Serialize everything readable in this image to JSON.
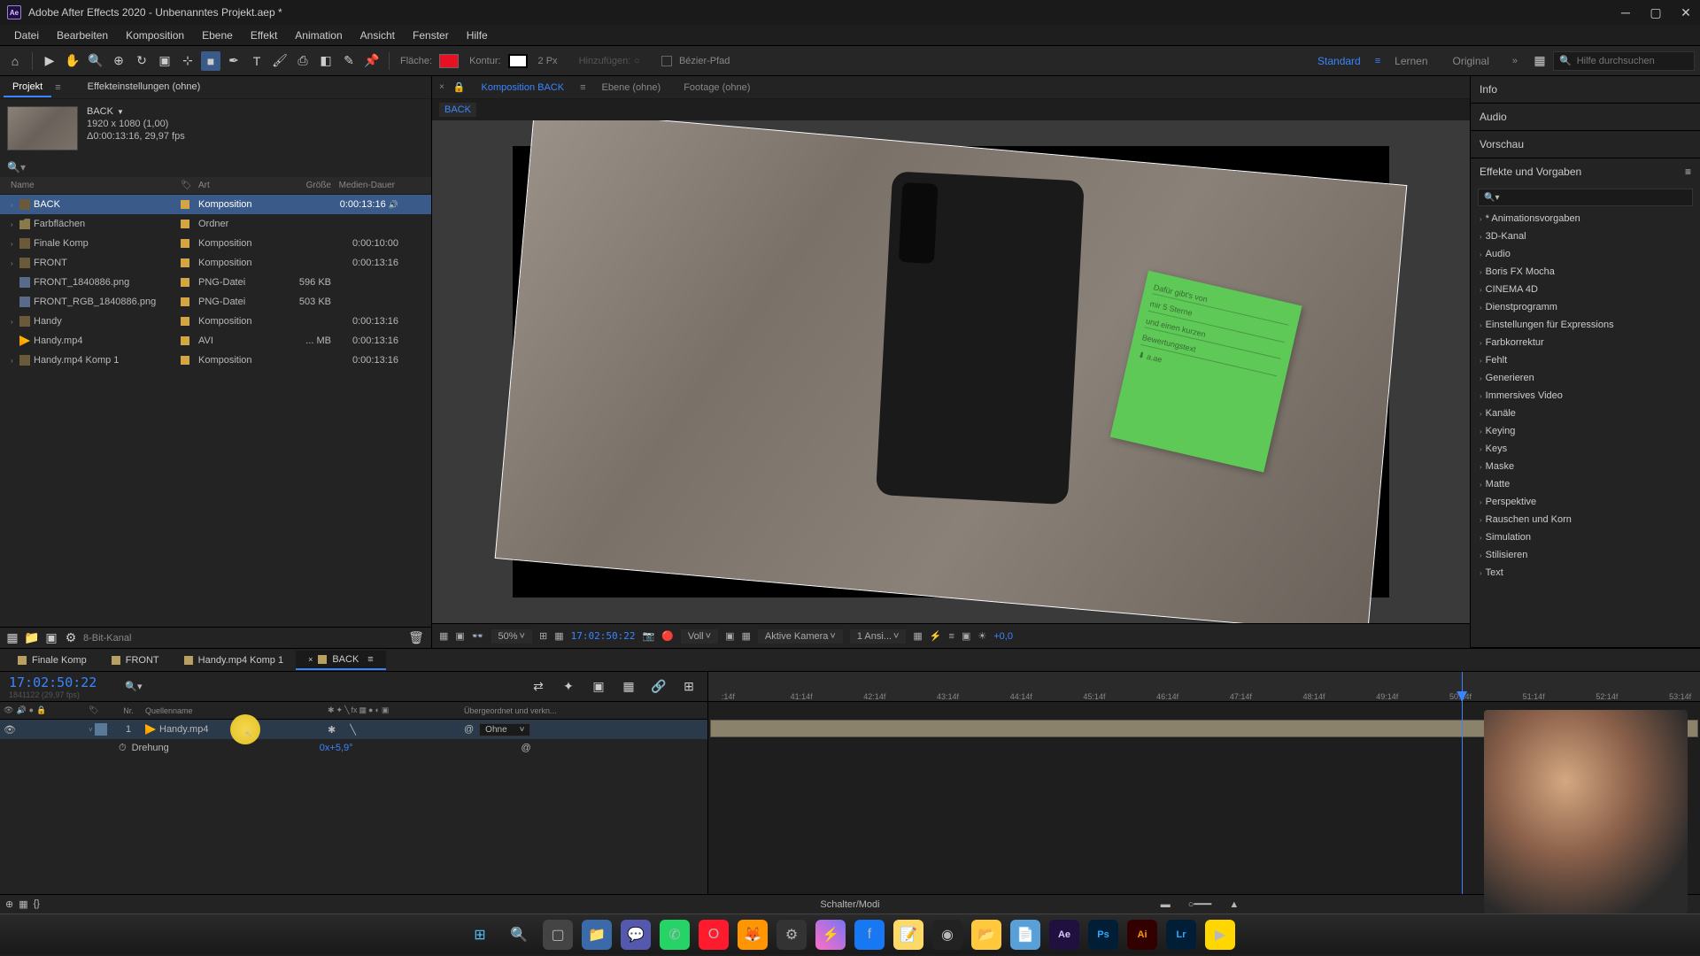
{
  "titlebar": {
    "app_name": "Adobe After Effects 2020",
    "project_title": "Unbenanntes Projekt.aep *"
  },
  "menu": [
    "Datei",
    "Bearbeiten",
    "Komposition",
    "Ebene",
    "Effekt",
    "Animation",
    "Ansicht",
    "Fenster",
    "Hilfe"
  ],
  "toolbar": {
    "fill_label": "Fläche:",
    "stroke_label": "Kontur:",
    "stroke_width": "2 Px",
    "add_label": "Hinzufügen:",
    "bezier_label": "Bézier-Pfad",
    "workspaces": [
      "Standard",
      "Lernen",
      "Original"
    ],
    "search_placeholder": "Hilfe durchsuchen"
  },
  "project_panel": {
    "tabs": {
      "project": "Projekt",
      "effect_settings": "Effekteinstellungen (ohne)"
    },
    "comp_preview": {
      "name": "BACK",
      "dimensions": "1920 x 1080 (1,00)",
      "duration": "Δ0:00:13:16, 29,97 fps"
    },
    "headers": {
      "name": "Name",
      "art": "Art",
      "size": "Größe",
      "dur": "Medien-Dauer"
    },
    "rows": [
      {
        "name": "BACK",
        "art": "Komposition",
        "size": "",
        "dur": "0:00:13:16",
        "icon": "comp",
        "selected": true,
        "trail": true
      },
      {
        "name": "Farbflächen",
        "art": "Ordner",
        "size": "",
        "dur": "",
        "icon": "folder"
      },
      {
        "name": "Finale Komp",
        "art": "Komposition",
        "size": "",
        "dur": "0:00:10:00",
        "icon": "comp"
      },
      {
        "name": "FRONT",
        "art": "Komposition",
        "size": "",
        "dur": "0:00:13:16",
        "icon": "comp"
      },
      {
        "name": "FRONT_1840886.png",
        "art": "PNG-Datei",
        "size": "596 KB",
        "dur": "",
        "icon": "img"
      },
      {
        "name": "FRONT_RGB_1840886.png",
        "art": "PNG-Datei",
        "size": "503 KB",
        "dur": "",
        "icon": "img"
      },
      {
        "name": "Handy",
        "art": "Komposition",
        "size": "",
        "dur": "0:00:13:16",
        "icon": "comp"
      },
      {
        "name": "Handy.mp4",
        "art": "AVI",
        "size": "... MB",
        "dur": "0:00:13:16",
        "icon": "vid"
      },
      {
        "name": "Handy.mp4 Komp 1",
        "art": "Komposition",
        "size": "",
        "dur": "0:00:13:16",
        "icon": "comp"
      }
    ],
    "footer_bpc": "8-Bit-Kanal"
  },
  "viewer": {
    "tabs": {
      "comp": "Komposition BACK",
      "layer": "Ebene (ohne)",
      "footage": "Footage (ohne)"
    },
    "breadcrumb": "BACK",
    "sticky_note_text": "Dafür gibt's von mir 5 Sterne und einen kurzen Bewertungstext ⬇ a.ae",
    "footer": {
      "zoom": "50%",
      "time": "17:02:50:22",
      "res": "Voll",
      "camera": "Aktive Kamera",
      "views": "1 Ansi...",
      "exposure": "+0,0"
    }
  },
  "right": {
    "sections": [
      "Info",
      "Audio",
      "Vorschau"
    ],
    "effects_title": "Effekte und Vorgaben",
    "effects": [
      "* Animationsvorgaben",
      "3D-Kanal",
      "Audio",
      "Boris FX Mocha",
      "CINEMA 4D",
      "Dienstprogramm",
      "Einstellungen für Expressions",
      "Farbkorrektur",
      "Fehlt",
      "Generieren",
      "Immersives Video",
      "Kanäle",
      "Keying",
      "Keys",
      "Maske",
      "Matte",
      "Perspektive",
      "Rauschen und Korn",
      "Simulation",
      "Stilisieren",
      "Text"
    ]
  },
  "timeline": {
    "tabs": [
      {
        "label": "Finale Komp",
        "active": false
      },
      {
        "label": "FRONT",
        "active": false
      },
      {
        "label": "Handy.mp4 Komp 1",
        "active": false
      },
      {
        "label": "BACK",
        "active": true
      }
    ],
    "timecode": "17:02:50:22",
    "timecode_sub": "1841122 (29,97 fps)",
    "headers": {
      "num": "Nr.",
      "source": "Quellenname",
      "parent": "Übergeordnet und verkn..."
    },
    "layer": {
      "num": "1",
      "name": "Handy.mp4",
      "parent_value": "Ohne",
      "prop_name": "Drehung",
      "prop_value": "0x+5,9°"
    },
    "ruler_ticks": [
      ":14f",
      "41:14f",
      "42:14f",
      "43:14f",
      "44:14f",
      "45:14f",
      "46:14f",
      "47:14f",
      "48:14f",
      "49:14f",
      "50:14f",
      "51:14f",
      "52:14f",
      "53:14f"
    ],
    "playhead_pos_pct": 76,
    "footer": "Schalter/Modi"
  },
  "colors": {
    "accent": "#3a85ff",
    "fill": "#e81123",
    "tag": "#d4a544",
    "highlight": "#f5d750"
  }
}
